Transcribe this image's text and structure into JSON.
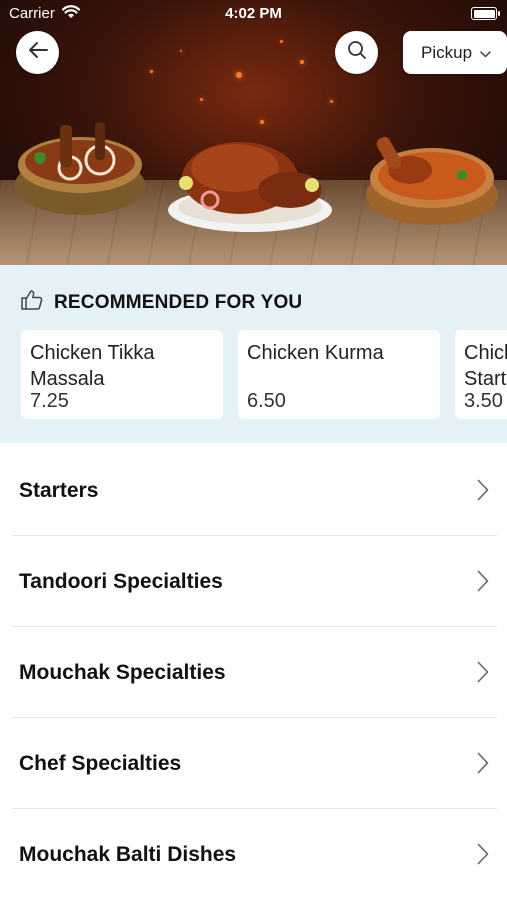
{
  "status_bar": {
    "carrier": "Carrier",
    "time": "4:02 PM"
  },
  "header": {
    "pickup_label": "Pickup"
  },
  "recommended": {
    "title": "RECOMMENDED FOR YOU",
    "items": [
      {
        "name": "Chicken Tikka Massala",
        "price": "7.25"
      },
      {
        "name": "Chicken Kurma",
        "price": "6.50"
      },
      {
        "name": "Chicken Tikka Starter",
        "price": "3.50"
      }
    ]
  },
  "categories": [
    {
      "label": "Starters"
    },
    {
      "label": "Tandoori Specialties"
    },
    {
      "label": "Mouchak Specialties"
    },
    {
      "label": "Chef Specialties"
    },
    {
      "label": "Mouchak Balti Dishes"
    }
  ],
  "icons": {
    "back": "arrow-left-icon",
    "search": "search-icon",
    "pickup": "chevron-down-icon",
    "recommended": "thumbs-up-icon",
    "category": "chevron-right-icon"
  }
}
